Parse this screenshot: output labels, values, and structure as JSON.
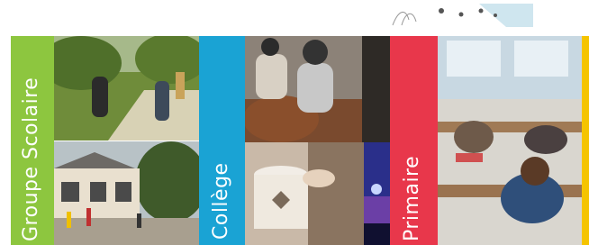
{
  "sections": [
    {
      "label": "Groupe Scolaire",
      "color": "#8dc63f"
    },
    {
      "label": "Collège",
      "color": "#1aa3d4"
    },
    {
      "label": "Primaire",
      "color": "#e8374b"
    }
  ],
  "accent_right": "#f5c400",
  "images": {
    "school_walk": "students-walking-photo",
    "school_building": "school-building-photo",
    "horse_riding": "horse-riding-photo",
    "drum_music": "drum-photo",
    "concert": "concert-photo",
    "classroom": "classroom-photo"
  }
}
